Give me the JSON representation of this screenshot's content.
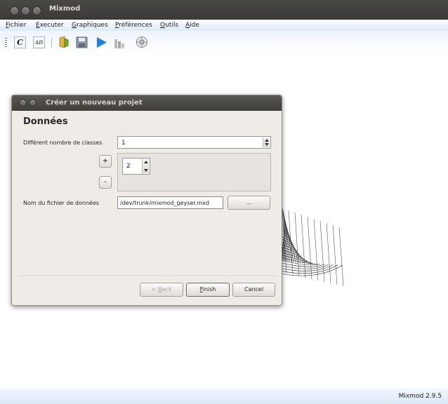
{
  "app": {
    "title": "Mixmod",
    "version": "Mixmod 2.9.5"
  },
  "menubar": {
    "items": [
      {
        "mnemonic": "F",
        "rest": "ichier"
      },
      {
        "mnemonic": "E",
        "rest": "xecuter"
      },
      {
        "mnemonic": "G",
        "rest": "raphiques"
      },
      {
        "mnemonic": "P",
        "rest": "références"
      },
      {
        "mnemonic": "O",
        "rest": "utils"
      },
      {
        "mnemonic": "A",
        "rest": "ide"
      }
    ]
  },
  "toolbar": {
    "c_label": "C",
    "ad_label": "AD",
    "icons": [
      "c-icon",
      "ad-icon",
      "open-project-icon",
      "save-icon",
      "run-icon",
      "graphics-icon",
      "preferences-icon"
    ]
  },
  "dialog": {
    "title": "Créer un nouveau projet",
    "heading": "Données",
    "classes_label": "Différent nombre de classes",
    "classes_value": "1",
    "plus_label": "+",
    "minus_label": "-",
    "class_spin_value": "2",
    "file_label": "Nom du fichier de données",
    "file_value": "/dev/trunk/mixmod_geyser.mxd",
    "browse_label": "...",
    "back_label_pre": "< ",
    "back_label_mn": "B",
    "back_label_rest": "ack",
    "finish_label_mn": "F",
    "finish_label_rest": "inish",
    "cancel_label": "Cancel"
  },
  "colors": {
    "run_blue": "#1f7fd9",
    "titlebar": "#3c3b37",
    "menubar": "#e6effa"
  }
}
